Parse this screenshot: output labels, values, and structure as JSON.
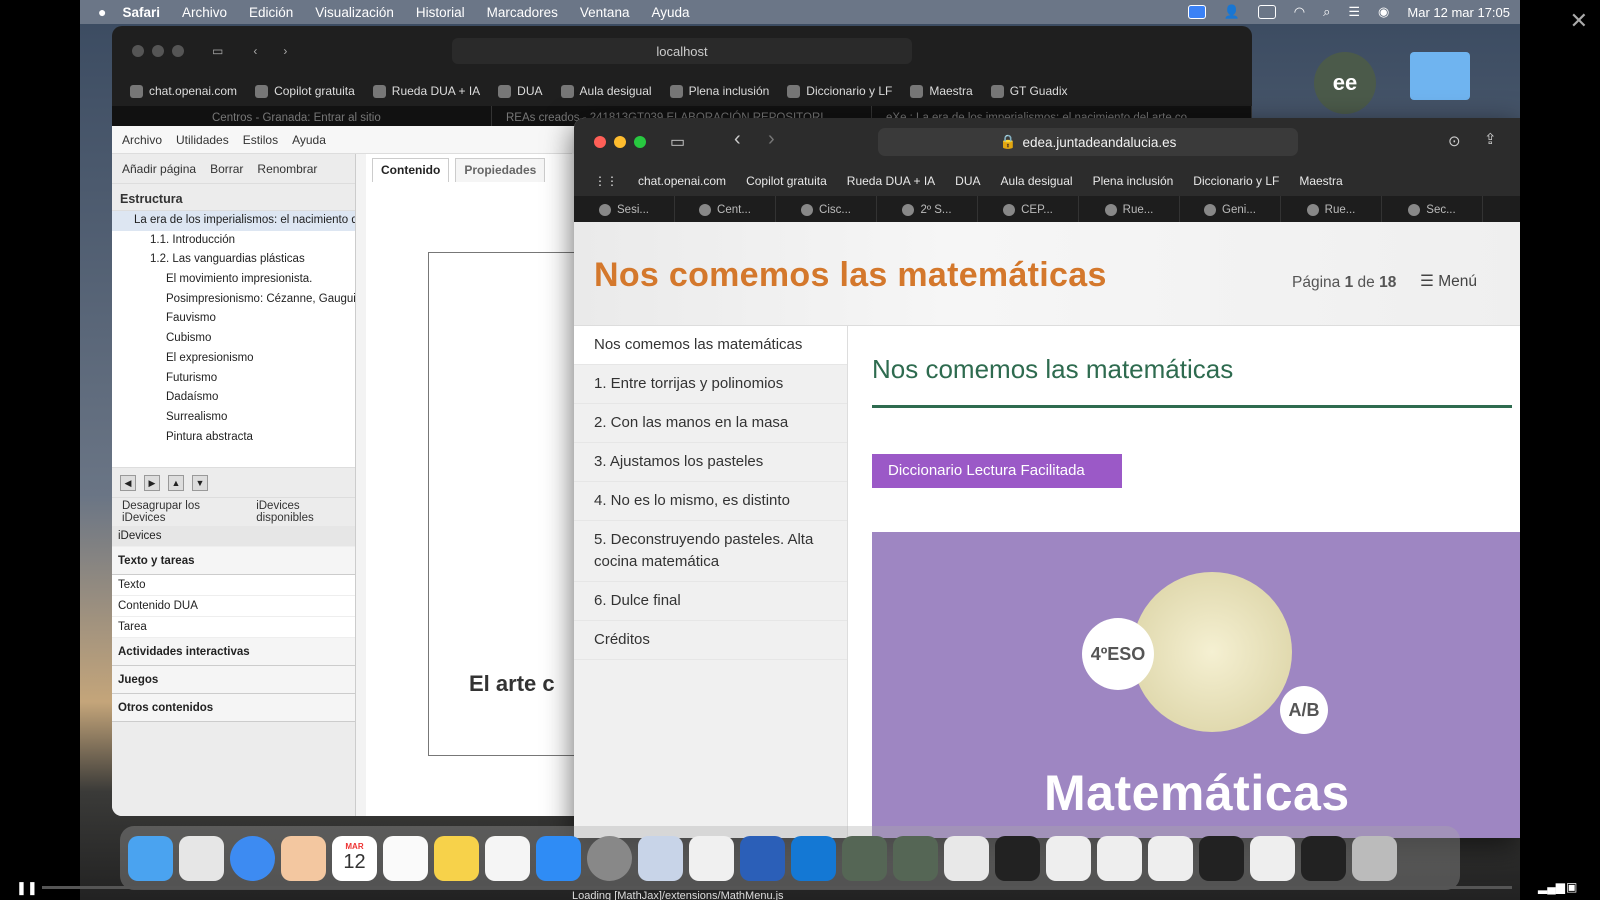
{
  "menubar": {
    "app": "Safari",
    "items": [
      "Archivo",
      "Edición",
      "Visualización",
      "Historial",
      "Marcadores",
      "Ventana",
      "Ayuda"
    ],
    "clock": "Mar 12 mar  17:05"
  },
  "back_window": {
    "url": "localhost",
    "bookmarks": [
      "chat.openai.com",
      "Copilot gratuita",
      "Rueda DUA + IA",
      "DUA",
      "Aula desigual",
      "Plena inclusión",
      "Diccionario y LF",
      "Maestra",
      "GT Guadix"
    ],
    "tabs": [
      "Centros - Granada: Entrar al sitio",
      "REAs creados - 241813GT039 ELABORACIÓN REPOSITORI...",
      "eXe : La era de los imperialismos: el nacimiento del arte co..."
    ]
  },
  "exe": {
    "menus": [
      "Archivo",
      "Utilidades",
      "Estilos",
      "Ayuda"
    ],
    "node_buttons": [
      "Añadir página",
      "Borrar",
      "Renombrar"
    ],
    "structure_title": "Estructura",
    "tree": [
      "La era de los imperialismos: el nacimiento del",
      "1.1. Introducción",
      "1.2. Las vanguardias plásticas",
      "El movimiento impresionista.",
      "Posimpresionismo: Cézanne, Gauguin, V",
      "Fauvismo",
      "Cubismo",
      "El expresionismo",
      "Futurismo",
      "Dadaísmo",
      "Surrealismo",
      "Pintura abstracta"
    ],
    "idevice_tabs": [
      "Desagrupar los iDevices",
      "iDevices disponibles"
    ],
    "idevices_label": "iDevices",
    "groups": {
      "texto": "Texto y tareas",
      "items": [
        "Texto",
        "Contenido DUA",
        "Tarea"
      ],
      "g2": "Actividades interactivas",
      "g3": "Juegos",
      "g4": "Otros contenidos"
    },
    "editor_tabs": [
      "Contenido",
      "Propiedades"
    ],
    "editor_title": "El arte c"
  },
  "front_window": {
    "url": "edea.juntadeandalucia.es",
    "bookmarks": [
      "chat.openai.com",
      "Copilot gratuita",
      "Rueda DUA + IA",
      "DUA",
      "Aula desigual",
      "Plena inclusión",
      "Diccionario y LF",
      "Maestra"
    ],
    "tabs": [
      "Sesi...",
      "Cent...",
      "Cisc...",
      "2º S...",
      "CEP...",
      "Rue...",
      "Geni...",
      "Rue...",
      "Sec..."
    ]
  },
  "site": {
    "title": "Nos comemos las matemáticas",
    "page_prefix": "Página",
    "page_current": "1",
    "page_sep": "de",
    "page_total": "18",
    "menu": "Menú",
    "nav": [
      "Nos comemos las matemáticas",
      "1. Entre torrijas y polinomios",
      "2. Con las manos en la masa",
      "3. Ajustamos los pasteles",
      "4. No es lo mismo, es distinto",
      "5. Deconstruyendo pasteles. Alta cocina matemática",
      "6. Dulce final",
      "Créditos"
    ],
    "heading": "Nos comemos las matemáticas",
    "dict_button": "Diccionario Lectura Facilitada",
    "cover": {
      "grade": "4ºESO",
      "option": "A/B",
      "subject": "Matemáticas"
    }
  },
  "dock": {
    "calendar_month": "MAR",
    "calendar_day": "12"
  },
  "status": {
    "loading": "Loading [MathJax]/extensions/MathMenu.js"
  }
}
